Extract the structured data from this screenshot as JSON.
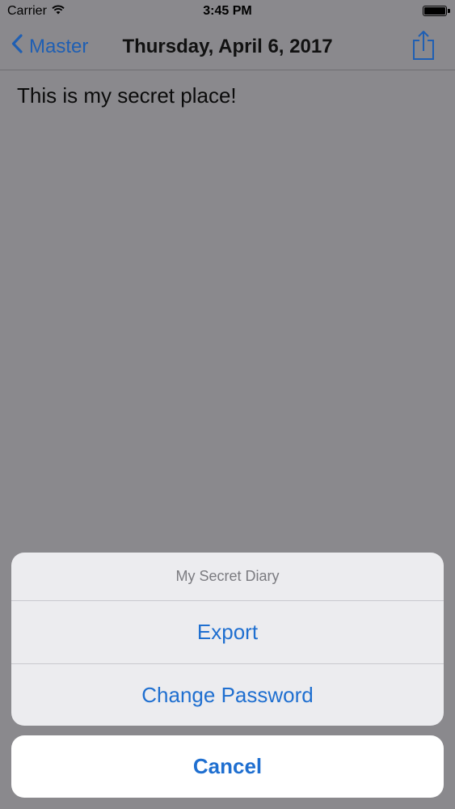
{
  "status_bar": {
    "carrier": "Carrier",
    "time": "3:45 PM",
    "wifi_icon": "wifi-icon",
    "battery_icon": "battery-icon",
    "battery_level": 1.0
  },
  "nav": {
    "back_label": "Master",
    "back_icon": "chevron-left-icon",
    "title": "Thursday, April 6, 2017",
    "share_icon": "share-icon"
  },
  "content": {
    "text": "This is my secret place!"
  },
  "action_sheet": {
    "title": "My Secret Diary",
    "actions": [
      "Export",
      "Change Password"
    ],
    "cancel_label": "Cancel"
  },
  "colors": {
    "accent": "#1f6fd0",
    "dim_background": "#8a898d",
    "sheet_background": "#ececef"
  }
}
